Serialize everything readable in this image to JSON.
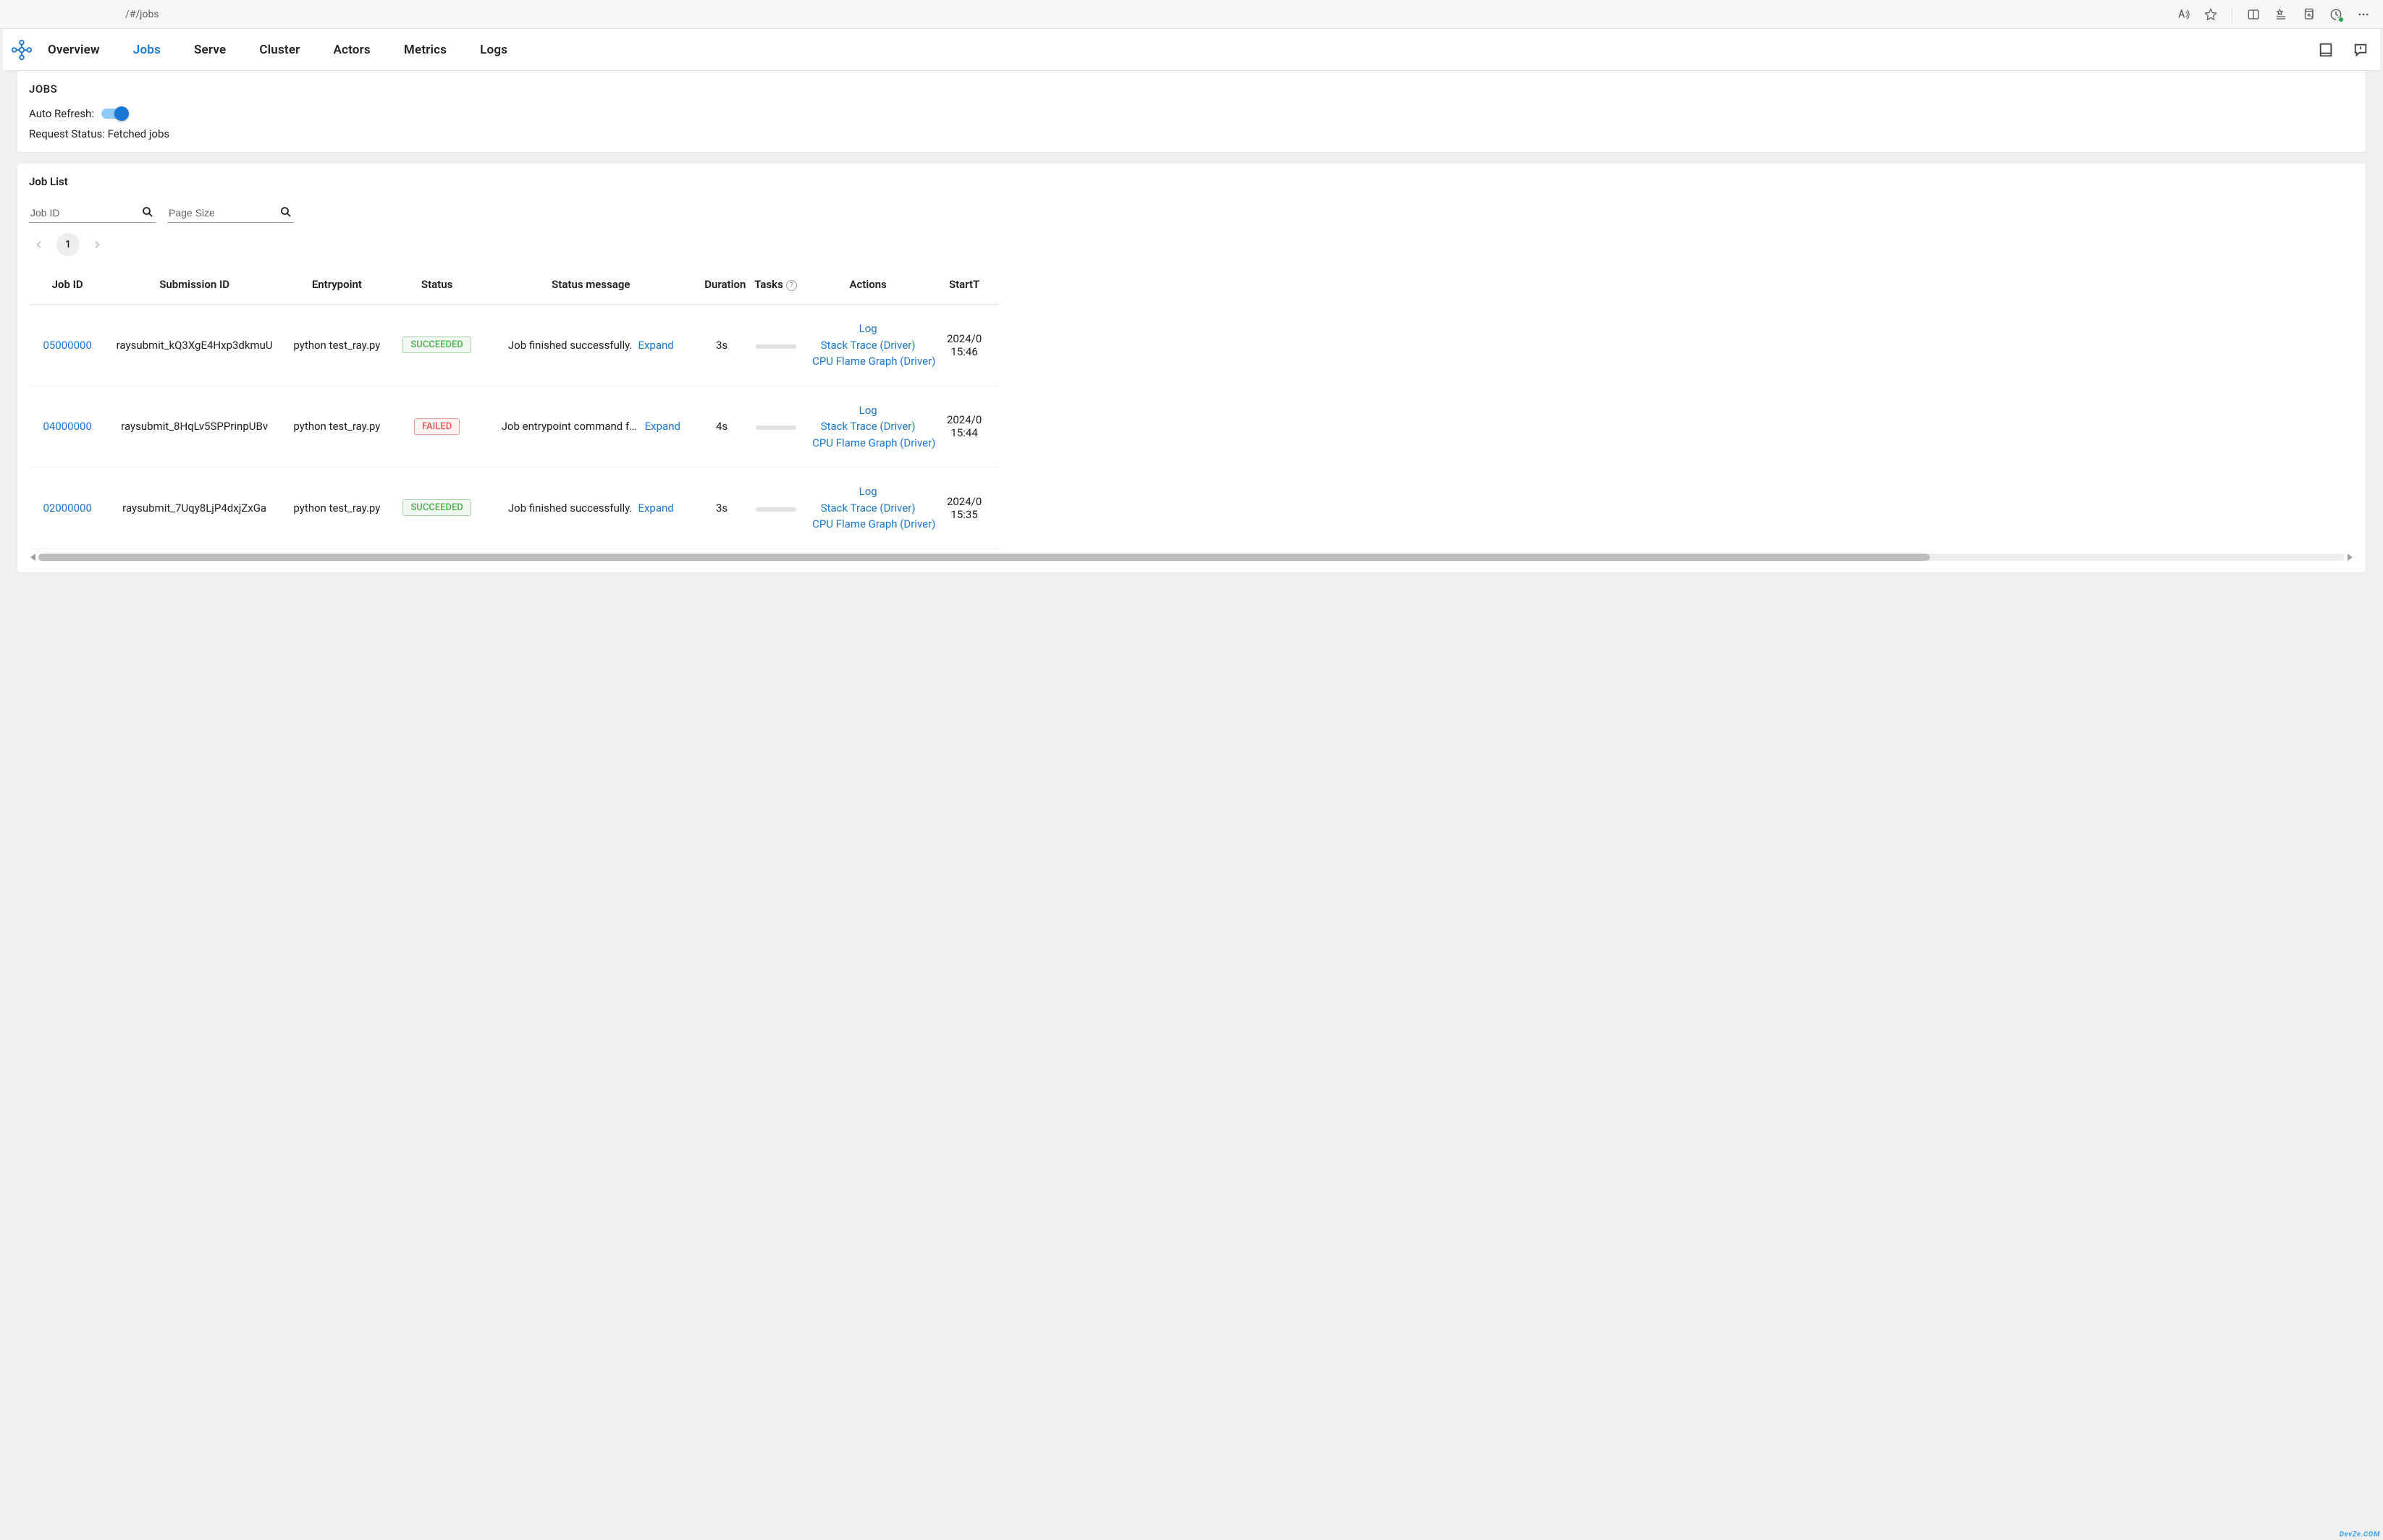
{
  "browser": {
    "url": "/#/jobs"
  },
  "nav": {
    "items": [
      "Overview",
      "Jobs",
      "Serve",
      "Cluster",
      "Actors",
      "Metrics",
      "Logs"
    ],
    "active_index": 1
  },
  "jobs_card": {
    "title": "JOBS",
    "auto_refresh_label": "Auto Refresh:",
    "auto_refresh_on": true,
    "request_status_label": "Request Status:",
    "request_status_value": "Fetched jobs"
  },
  "joblist": {
    "title": "Job List",
    "search_jobid_placeholder": "Job ID",
    "search_pagesize_placeholder": "Page Size",
    "page": 1,
    "columns": [
      "Job ID",
      "Submission ID",
      "Entrypoint",
      "Status",
      "Status message",
      "Duration",
      "Tasks",
      "Actions",
      "StartT"
    ],
    "expand_label": "Expand",
    "actions": [
      "Log",
      "Stack Trace (Driver)",
      "CPU Flame Graph (Driver)"
    ],
    "rows": [
      {
        "job_id": "05000000",
        "submission_id": "raysubmit_kQ3XgE4Hxp3dkmuU",
        "entrypoint": "python test_ray.py",
        "status": "SUCCEEDED",
        "status_class": "succ",
        "status_message": "Job finished successfully.",
        "duration": "3s",
        "start_time": "2024/0\n15:46"
      },
      {
        "job_id": "04000000",
        "submission_id": "raysubmit_8HqLv5SPPrinpUBv",
        "entrypoint": "python test_ray.py",
        "status": "FAILED",
        "status_class": "fail",
        "status_message": "Job entrypoint command faile…",
        "duration": "4s",
        "start_time": "2024/0\n15:44"
      },
      {
        "job_id": "02000000",
        "submission_id": "raysubmit_7Uqy8LjP4dxjZxGa",
        "entrypoint": "python test_ray.py",
        "status": "SUCCEEDED",
        "status_class": "succ",
        "status_message": "Job finished successfully.",
        "duration": "3s",
        "start_time": "2024/0\n15:35"
      }
    ]
  },
  "watermark": "DevZe.COM"
}
